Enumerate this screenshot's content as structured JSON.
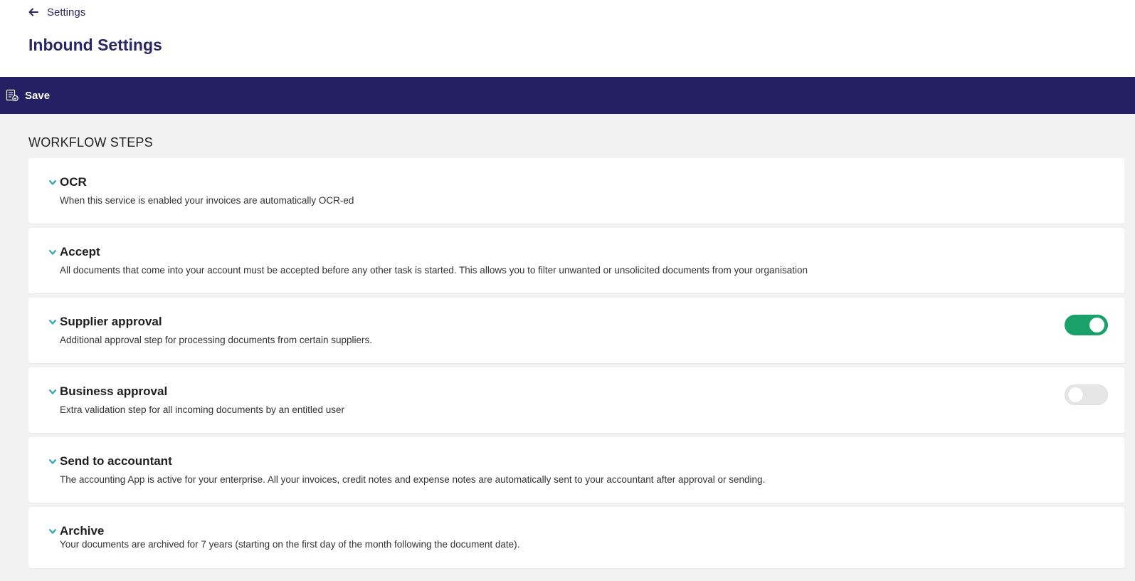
{
  "header": {
    "back_label": "Settings",
    "page_title": "Inbound Settings"
  },
  "toolbar": {
    "save_label": "Save"
  },
  "section": {
    "title": "WORKFLOW STEPS"
  },
  "colors": {
    "brand": "#252063",
    "title": "#2b2666",
    "chevron": "#3aa7b0",
    "toggle_on": "#1aa169",
    "toggle_off": "#e6e6e6"
  },
  "steps": [
    {
      "title": "OCR",
      "description": "When this service is enabled your invoices are automatically OCR-ed"
    },
    {
      "title": "Accept",
      "description": "All documents that come into your account must be accepted before any other task is started. This allows you to filter unwanted or unsolicited documents from your organisation"
    },
    {
      "title": "Supplier approval",
      "description": "Additional approval step for processing documents from certain suppliers.",
      "toggle": true
    },
    {
      "title": "Business approval",
      "description": "Extra validation step for all incoming documents by an entitled user",
      "toggle": false
    },
    {
      "title": "Send to accountant",
      "description": "The accounting App is active for your enterprise. All your invoices, credit notes and expense notes are automatically sent to your accountant after approval or sending."
    },
    {
      "title": "Archive",
      "description": "Your documents are archived for 7 years (starting on the first day of the month following the document date)."
    }
  ]
}
